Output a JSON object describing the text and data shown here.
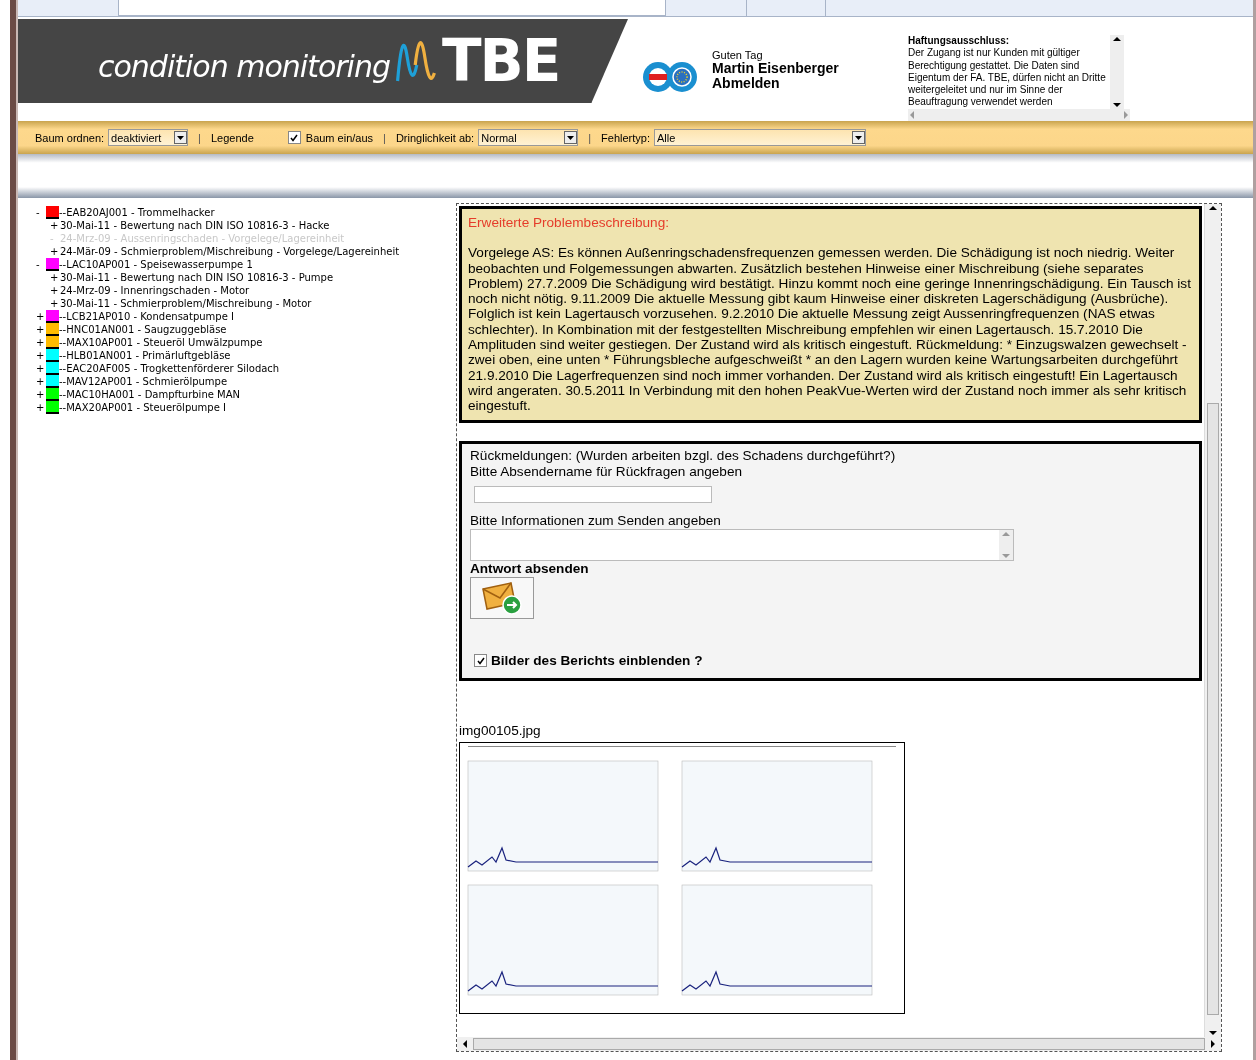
{
  "header": {
    "tagline": "condition monitoring",
    "brand": "TBE",
    "greeting": "Guten Tag",
    "user": "Martin Eisenberger",
    "logout": "Abmelden",
    "disclaimer": {
      "title": "Haftungsausschluss:",
      "text": "Der Zugang ist nur Kunden mit gültiger Berechtigung gestattet. Die Daten sind Eigentum der FA. TBE, dürfen nicht an Dritte weitergeleitet und nur im Sinne der Beauftragung verwendet werden"
    }
  },
  "toolbar": [
    {
      "kind": "select",
      "label": "Baum ordnen:",
      "value": "deaktiviert"
    },
    {
      "kind": "separator",
      "text": "|"
    },
    {
      "kind": "link",
      "text": "Legende"
    },
    {
      "kind": "checkbox",
      "label": "Baum ein/aus",
      "checked": true
    },
    {
      "kind": "separator",
      "text": "|"
    },
    {
      "kind": "select",
      "label": "Dringlichkeit ab:",
      "value": "Normal"
    },
    {
      "kind": "separator",
      "text": "|"
    },
    {
      "kind": "select",
      "label": "Fehlertyp:",
      "value": "Alle"
    }
  ],
  "tree": [
    {
      "toggle": "-",
      "color": "#ff0000",
      "label": "--EAB20AJ001 - Trommelhacker",
      "children": [
        {
          "toggle": "+",
          "label": "30-Mai-11 - Bewertung nach DIN ISO 10816-3 - Hacke",
          "disabled": false
        },
        {
          "toggle": "-",
          "label": "24-Mrz-09 - Aussenringschaden - Vorgelege/Lagereinheit",
          "disabled": true
        },
        {
          "toggle": "+",
          "label": "24-Mär-09 - Schmierproblem/Mischreibung - Vorgelege/Lagereinheit",
          "disabled": false
        }
      ]
    },
    {
      "toggle": "-",
      "color": "#ff00ff",
      "label": "--LAC10AP001 - Speisewasserpumpe 1",
      "children": [
        {
          "toggle": "+",
          "label": "30-Mai-11 - Bewertung nach DIN ISO 10816-3 - Pumpe",
          "disabled": false
        },
        {
          "toggle": "+",
          "label": "24-Mrz-09 - Innenringschaden - Motor",
          "disabled": false
        },
        {
          "toggle": "+",
          "label": "30-Mai-11 - Schmierproblem/Mischreibung - Motor",
          "disabled": false
        }
      ]
    },
    {
      "toggle": "+",
      "color": "#ff00ff",
      "label": "--LCB21AP010 - Kondensatpumpe I"
    },
    {
      "toggle": "+",
      "color": "#ffbb00",
      "label": "--HNC01AN001 - Saugzuggebläse"
    },
    {
      "toggle": "+",
      "color": "#ffbb00",
      "label": "--MAX10AP001 - Steueröl Umwälzpumpe"
    },
    {
      "toggle": "+",
      "color": "#00ffff",
      "label": "--HLB01AN001 - Primärluftgebläse"
    },
    {
      "toggle": "+",
      "color": "#00ffff",
      "label": "--EAC20AF005 - Trogkettenförderer Silodach"
    },
    {
      "toggle": "+",
      "color": "#00ffff",
      "label": "--MAV12AP001 - Schmierölpumpe"
    },
    {
      "toggle": "+",
      "color": "#00ff00",
      "label": "--MAC10HA001 - Dampfturbine MAN"
    },
    {
      "toggle": "+",
      "color": "#00ff00",
      "label": "--MAX20AP001 - Steuerölpumpe I"
    }
  ],
  "problem": {
    "title": "Erweiterte Problembeschreibung:",
    "text": "Vorgelege AS: Es können Außenringschadensfrequenzen gemessen werden. Die Schädigung ist noch niedrig. Weiter beobachten und Folgemessungen abwarten. Zusätzlich bestehen Hinweise einer Mischreibung (siehe separates Problem) 27.7.2009 Die Schädigung wird bestätigt. Hinzu kommt noch eine geringe Innenringschädigung. Ein Tausch ist noch nicht nötig. 9.11.2009 Die aktuelle Messung gibt kaum Hinweise einer diskreten Lagerschädigung (Ausbrüche). Folglich ist kein Lagertausch vorzusehen. 9.2.2010 Die aktuelle Messung zeigt Aussenringfrequenzen (NAS etwas schlechter). In Kombination mit der festgestellten Mischreibung empfehlen wir einen Lagertausch. 15.7.2010 Die Amplituden sind weiter gestiegen. Der Zustand wird als kritisch eingestuft. Rückmeldung: * Einzugswalzen gewechselt - zwei oben, eine unten * Führungsbleche aufgeschweißt * an den Lagern wurden keine Wartungsarbeiten durchgeführt 21.9.2010 Die Lagerfrequenzen sind noch immer vorhanden. Der Zustand wird als kritisch eingestuft! Ein Lagertausch wird angeraten. 30.5.2011 In Verbindung mit den hohen PeakVue-Werten wird der Zustand noch immer als sehr kritisch eingestuft."
  },
  "feedback": {
    "heading": "Rückmeldungen: (Wurden arbeiten bzgl. des Schadens durchgeführt?)",
    "name_label": "Bitte Absendername für Rückfragen angeben",
    "info_label": "Bitte Informationen zum Senden angeben",
    "send_label": "Antwort absenden",
    "show_images": {
      "label": "Bilder des Berichts einblenden ?",
      "checked": true
    }
  },
  "images": [
    {
      "caption": "img00105.jpg",
      "kind": "picture"
    }
  ]
}
